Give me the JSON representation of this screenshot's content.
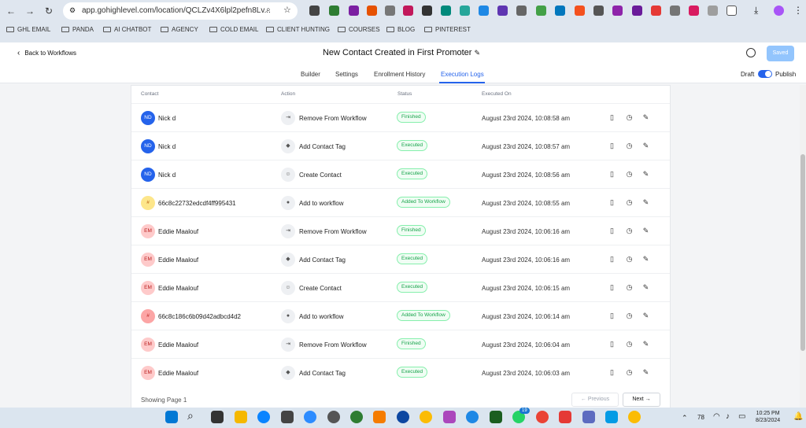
{
  "browser": {
    "url": "app.gohighlevel.com/location/QCLZv4X6lpl2pefn8Lv...",
    "bookmarks": [
      "GHL EMAIL",
      "PANDA",
      "AI CHATBOT",
      "AGENCY",
      "COLD EMAIL",
      "CLIENT HUNTING",
      "COURSES",
      "BLOG",
      "PINTEREST"
    ]
  },
  "header": {
    "back_label": "Back to Workflows",
    "title": "New Contact Created in First Promoter",
    "saved_label": "Saved",
    "tabs": [
      "Builder",
      "Settings",
      "Enrollment History",
      "Execution Logs"
    ],
    "active_tab": "Execution Logs",
    "draft_label": "Draft",
    "publish_label": "Publish"
  },
  "table": {
    "columns": [
      "Contact",
      "Action",
      "Status",
      "Executed On"
    ],
    "rows": [
      {
        "initials": "ND",
        "contact": "Nick d",
        "action": "Remove From Workflow",
        "status": "Finished",
        "executed_on": "August 23rd 2024, 10:08:58 am"
      },
      {
        "initials": "ND",
        "contact": "Nick d",
        "action": "Add Contact Tag",
        "status": "Executed",
        "executed_on": "August 23rd 2024, 10:08:57 am"
      },
      {
        "initials": "ND",
        "contact": "Nick d",
        "action": "Create Contact",
        "status": "Executed",
        "executed_on": "August 23rd 2024, 10:08:56 am"
      },
      {
        "initials": "#",
        "contact": "66c8c22732edcdf4ff995431",
        "action": "Add to workflow",
        "status": "Added To Workflow",
        "executed_on": "August 23rd 2024, 10:08:55 am"
      },
      {
        "initials": "EM",
        "contact": "Eddie Maalouf",
        "action": "Remove From Workflow",
        "status": "Finished",
        "executed_on": "August 23rd 2024, 10:06:16 am"
      },
      {
        "initials": "EM",
        "contact": "Eddie Maalouf",
        "action": "Add Contact Tag",
        "status": "Executed",
        "executed_on": "August 23rd 2024, 10:06:16 am"
      },
      {
        "initials": "EM",
        "contact": "Eddie Maalouf",
        "action": "Create Contact",
        "status": "Executed",
        "executed_on": "August 23rd 2024, 10:06:15 am"
      },
      {
        "initials": "#",
        "contact": "66c8c186c6b09d42adbcd4d2",
        "action": "Add to workflow",
        "status": "Added To Workflow",
        "executed_on": "August 23rd 2024, 10:06:14 am"
      },
      {
        "initials": "EM",
        "contact": "Eddie Maalouf",
        "action": "Remove From Workflow",
        "status": "Finished",
        "executed_on": "August 23rd 2024, 10:06:04 am"
      },
      {
        "initials": "EM",
        "contact": "Eddie Maalouf",
        "action": "Add Contact Tag",
        "status": "Executed",
        "executed_on": "August 23rd 2024, 10:06:03 am"
      }
    ]
  },
  "pagination": {
    "showing": "Showing Page 1",
    "prev_label": "← Previous",
    "next_label": "Next →"
  },
  "taskbar": {
    "temperature": "78",
    "time": "10:25 PM",
    "date": "8/23/2024",
    "badge_count": "19"
  },
  "colors": {
    "accent": "#2563eb",
    "status_green": "#16a34a",
    "avatar_nd": "#2563eb",
    "avatar_em": "#fecaca",
    "avatar_hash_yellow": "#fde68a",
    "avatar_hash_red": "#fca5a5"
  }
}
